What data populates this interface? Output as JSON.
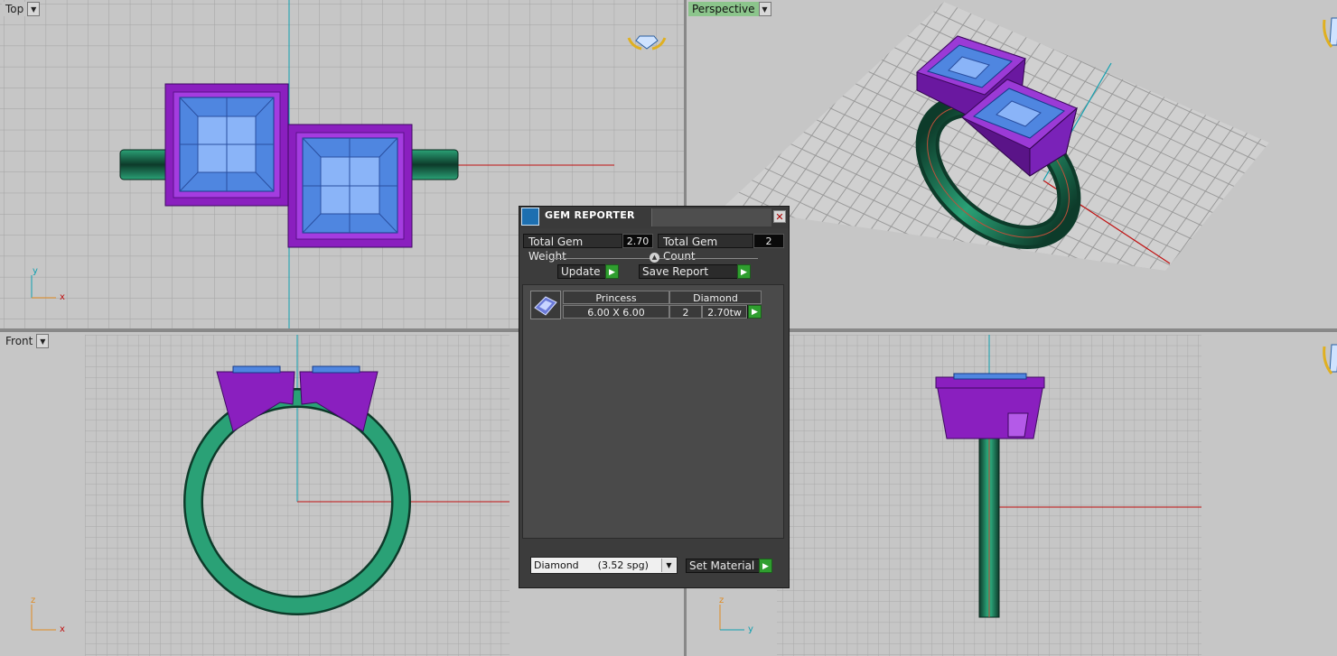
{
  "viewports": {
    "top": {
      "label": "Top",
      "axis_x": "x",
      "axis_y": "y"
    },
    "perspective": {
      "label": "Perspective"
    },
    "front": {
      "label": "Front",
      "axis_x": "x",
      "axis_y": "z"
    },
    "side": {
      "axis_x": "y",
      "axis_y": "z"
    }
  },
  "gem_reporter": {
    "title": "GEM REPORTER",
    "close_icon": "close-icon",
    "total_weight_label": "Total Gem Weight",
    "total_weight_value": "2.70",
    "total_count_label": "Total Gem Count",
    "total_count_value": "2",
    "update_label": "Update",
    "save_report_label": "Save Report",
    "gems": [
      {
        "cut": "Princess",
        "material": "Diamond",
        "size": "6.00 X 6.00",
        "count": "2",
        "weight": "2.70tw",
        "icon": "princess-gem-icon"
      }
    ],
    "material_select": "Diamond      (3.52 spg)",
    "set_material_label": "Set Material"
  },
  "colors": {
    "viewport_bg": "#c6c6c6",
    "grid": "#a3a3a3",
    "band_green": "#2aa176",
    "head_purple": "#8a1fbf",
    "gem_blue": "#4f86e0",
    "axis_red": "#c01010",
    "axis_cyan": "#10a0b0",
    "active_viewport_label": "#8cc58c"
  }
}
